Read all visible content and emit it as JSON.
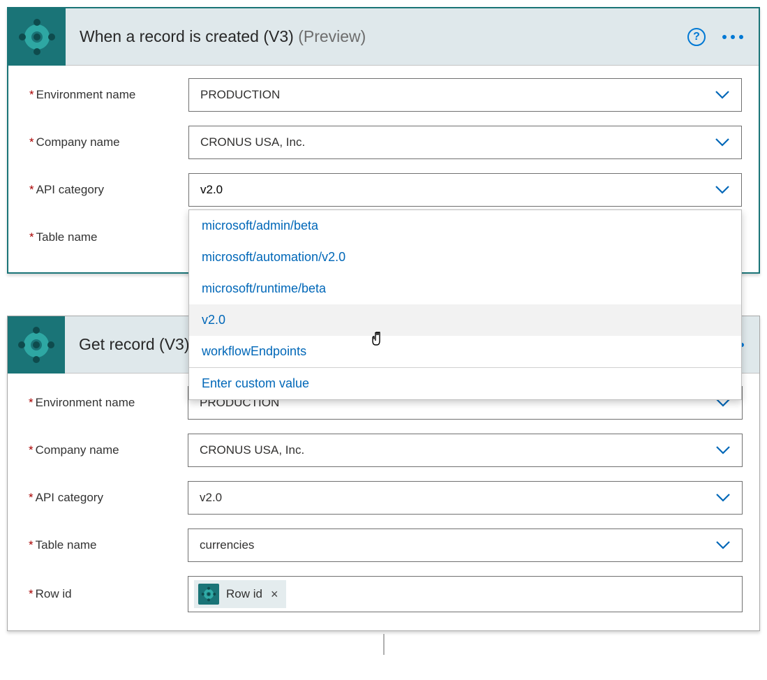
{
  "trigger": {
    "title": "When a record is created (V3)",
    "preview": "(Preview)",
    "fields": {
      "env_label": "Environment name",
      "env_value": "PRODUCTION",
      "company_label": "Company name",
      "company_value": "CRONUS USA, Inc.",
      "api_label": "API category",
      "api_value": "v2.0",
      "table_label": "Table name"
    },
    "dropdown": {
      "options": [
        "microsoft/admin/beta",
        "microsoft/automation/v2.0",
        "microsoft/runtime/beta",
        "v2.0",
        "workflowEndpoints"
      ],
      "custom": "Enter custom value"
    }
  },
  "action": {
    "title": "Get record (V3)",
    "fields": {
      "env_label": "Environment name",
      "env_value": "PRODUCTION",
      "company_label": "Company name",
      "company_value": "CRONUS USA, Inc.",
      "api_label": "API category",
      "api_value": "v2.0",
      "table_label": "Table name",
      "table_value": "currencies",
      "rowid_label": "Row id",
      "rowid_token": "Row id"
    }
  }
}
